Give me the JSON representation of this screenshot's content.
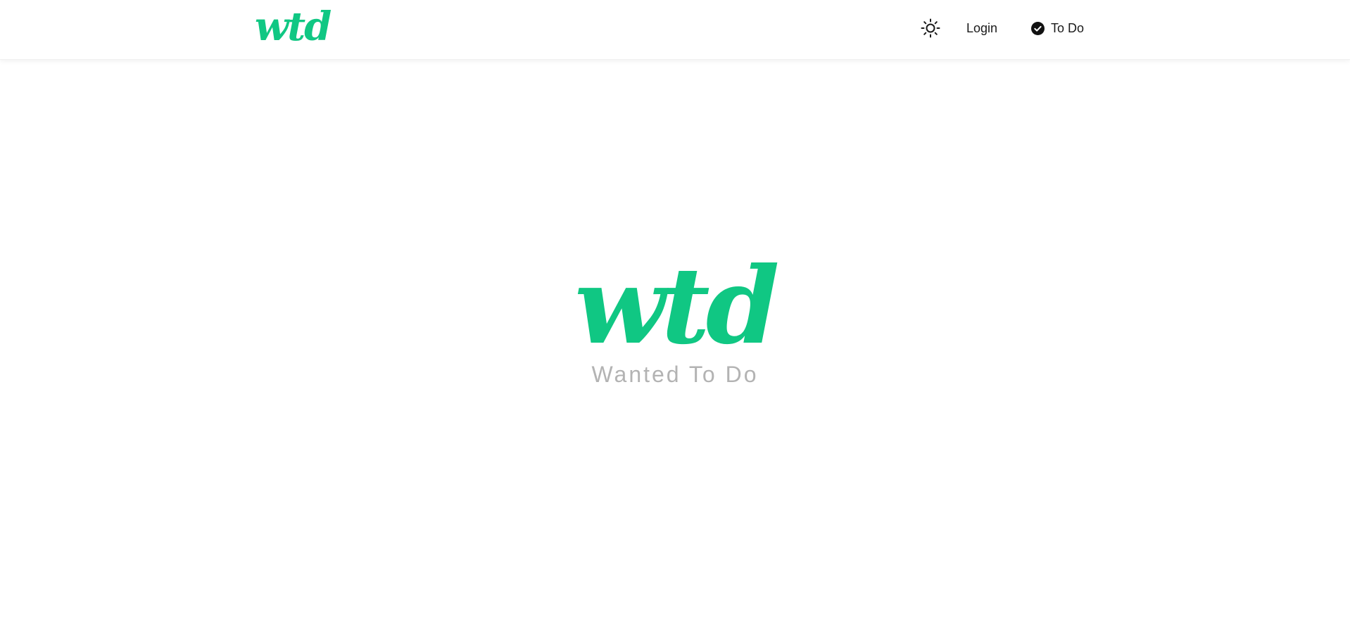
{
  "header": {
    "brand": "wtd",
    "theme_toggle_icon": "sun-icon",
    "login_label": "Login",
    "todo_label": "To Do",
    "todo_icon": "check-circle-icon"
  },
  "hero": {
    "logo": "wtd",
    "tagline": "Wanted To Do"
  },
  "colors": {
    "brand": "#10c783",
    "text": "#1a1a1a",
    "tagline": "#b3b3b3",
    "background": "#ffffff"
  }
}
